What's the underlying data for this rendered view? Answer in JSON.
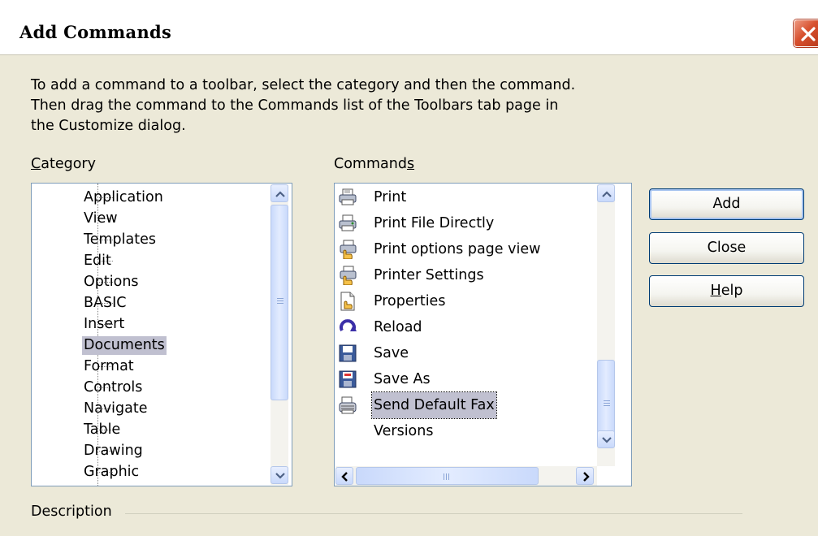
{
  "window": {
    "title": "Add Commands"
  },
  "intro": {
    "line1": "To add a command to a toolbar, select the category and then the command.",
    "line2": "Then drag the command to the Commands list of the Toolbars tab page in",
    "line3": "the Customize dialog."
  },
  "category": {
    "label_mnemonic": "C",
    "label_rest": "ategory",
    "items": [
      "Application",
      "View",
      "Templates",
      "Edit",
      "Options",
      "BASIC",
      "Insert",
      "Documents",
      "Format",
      "Controls",
      "Navigate",
      "Table",
      "Drawing",
      "Graphic"
    ],
    "selected": "Documents"
  },
  "commands": {
    "label_main": "Command",
    "label_mnemonic": "s",
    "items": [
      {
        "label": "Print",
        "icon": "printer-icon"
      },
      {
        "label": "Print File Directly",
        "icon": "print-direct-icon"
      },
      {
        "label": "Print options page view",
        "icon": "print-options-icon"
      },
      {
        "label": "Printer Settings",
        "icon": "printer-settings-icon"
      },
      {
        "label": "Properties",
        "icon": "properties-icon"
      },
      {
        "label": "Reload",
        "icon": "reload-icon"
      },
      {
        "label": "Save",
        "icon": "save-icon"
      },
      {
        "label": "Save As",
        "icon": "save-as-icon"
      },
      {
        "label": "Send Default Fax",
        "icon": "fax-icon"
      },
      {
        "label": "Versions",
        "icon": ""
      }
    ],
    "selected": "Send Default Fax"
  },
  "buttons": {
    "add": "Add",
    "close": "Close",
    "help_mnemonic": "H",
    "help_rest": "elp"
  },
  "description": {
    "label": "Description"
  },
  "colors": {
    "close_button": "#d7502e",
    "selection": "#c0c0d0",
    "dialog_bg": "#ece9d8",
    "border": "#7f9db9"
  }
}
